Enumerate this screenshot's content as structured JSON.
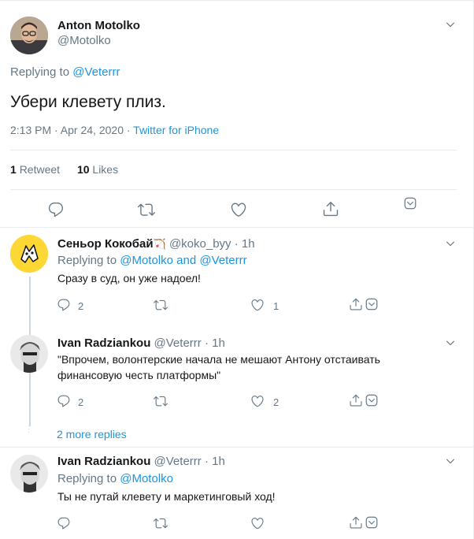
{
  "main_tweet": {
    "author_name": "Anton Motolko",
    "author_handle": "@Motolko",
    "replying_prefix": "Replying to",
    "replying_to": "@Veterrr",
    "text": "Убери клевету плиз.",
    "timestamp": "2:13 PM · Apr 24, 2020 ·",
    "source": "Twitter for iPhone",
    "retweets_count": "1",
    "retweets_label": "Retweet",
    "likes_count": "10",
    "likes_label": "Likes"
  },
  "replies": [
    {
      "author_name": "Сеньор Кокобай",
      "author_handle": "@koko_byy",
      "time": "· 1h",
      "replying_prefix": "Replying to",
      "replying_to_1": "@Motolko",
      "replying_and": "and",
      "replying_to_2": "@Veterrr",
      "text": "Сразу в суд, он уже надоел!",
      "reply_count": "2",
      "like_count": "1"
    },
    {
      "author_name": "Ivan Radziankou",
      "author_handle": "@Veterrr",
      "time": "· 1h",
      "text_line1": "\"Впрочем, волонтерские начала не мешают Антону отстаивать",
      "text_line2": "финансовую честь платформы\"",
      "reply_count": "2",
      "like_count": "2"
    },
    {
      "author_name": "Ivan Radziankou",
      "author_handle": "@Veterrr",
      "time": "· 1h",
      "replying_prefix": "Replying to",
      "replying_to": "@Motolko",
      "text": "Ты не путай клевету и маркетинговый ход!"
    }
  ],
  "more_replies": "2 more replies",
  "icons": {
    "reply": "reply-icon",
    "retweet": "retweet-icon",
    "like": "heart-icon",
    "share": "share-icon",
    "more": "chevron-down-icon",
    "emoji": "bow-arrow-emoji"
  },
  "colors": {
    "link": "#1b95e0",
    "secondary": "#657786",
    "border": "#e6ecf0",
    "thread": "#ccd6dd"
  }
}
